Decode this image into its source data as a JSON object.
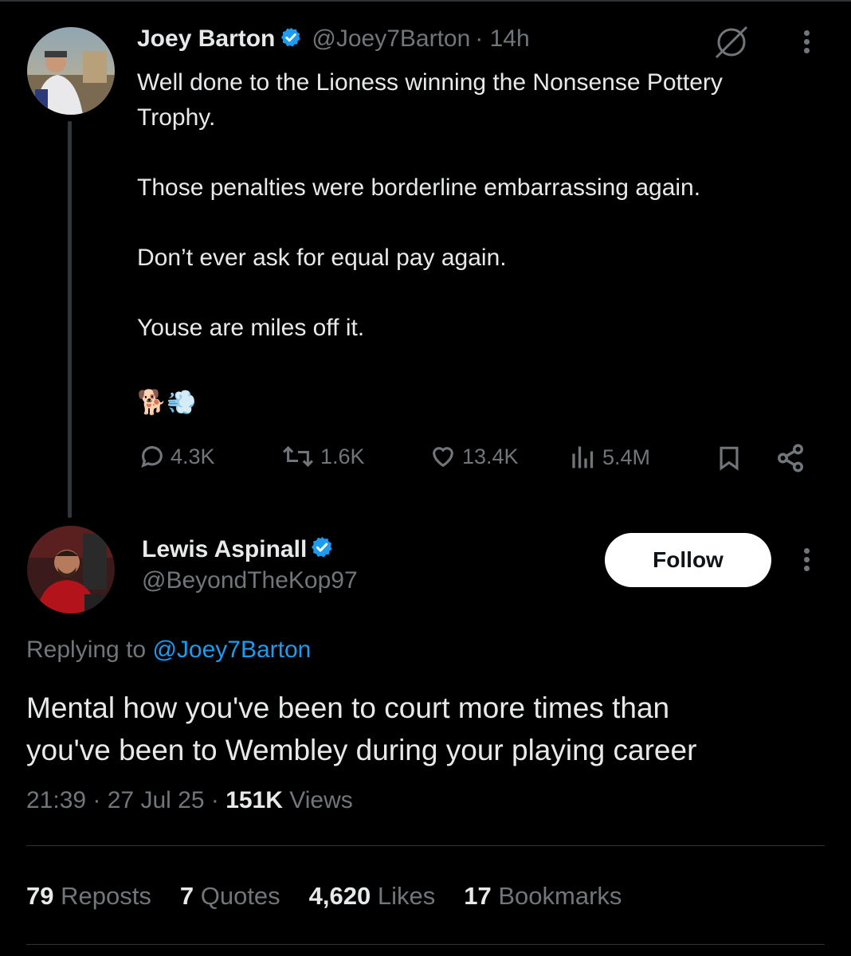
{
  "tweet": {
    "author_name": "Joey Barton",
    "author_handle": "@Joey7Barton",
    "time": "· 14h",
    "text": "Well done to the Lioness winning the Nonsense Pottery\nTrophy.\n\nThose penalties were borderline embarrassing again.\n\nDon’t ever ask for equal pay again.\n\nYouse are miles off it.",
    "emoji": "🐕💨",
    "replies": "4.3K",
    "reposts": "1.6K",
    "likes": "13.4K",
    "views": "5.4M",
    "icons": {
      "reply": "reply-icon",
      "repost": "repost-icon",
      "like": "heart-icon",
      "views": "views-icon",
      "bookmark": "bookmark-icon",
      "share": "share-icon",
      "grok": "grok-icon",
      "more": "more-icon"
    }
  },
  "reply": {
    "author_name": "Lewis Aspinall",
    "author_handle": "@BeyondTheKop97",
    "follow_label": "Follow",
    "replying_to_prefix": "Replying to ",
    "replying_to_handle": "@Joey7Barton",
    "text": "Mental how you've been to court more times than\nyou've been to Wembley during your playing career",
    "time": "21:39",
    "date": "· 27 Jul 25 ·",
    "views_count": "151K",
    "views_label": "Views",
    "stats": {
      "reposts_count": "79",
      "reposts_label": "Reposts",
      "quotes_count": "7",
      "quotes_label": "Quotes",
      "likes_count": "4,620",
      "likes_label": "Likes",
      "bookmarks_count": "17",
      "bookmarks_label": "Bookmarks"
    }
  },
  "colors": {
    "background": "#000000",
    "text": "#e7e9ea",
    "secondary": "#71767b",
    "accent": "#1d9bf0",
    "divider": "#2f3336"
  }
}
